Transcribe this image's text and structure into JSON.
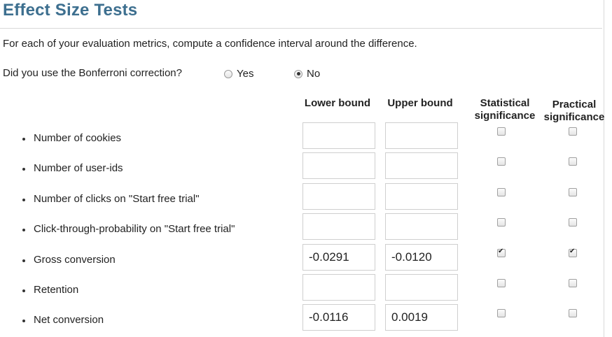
{
  "page": {
    "title": "Effect Size Tests",
    "intro": "For each of your evaluation metrics, compute a confidence interval around the difference."
  },
  "bonferroni": {
    "question": "Did you use the Bonferroni correction?",
    "options": [
      {
        "label": "Yes",
        "checked": false
      },
      {
        "label": "No",
        "checked": true
      }
    ]
  },
  "columns": {
    "lower": "Lower bound",
    "upper": "Upper bound",
    "stat_line1": "Statistical",
    "stat_line2": "significance",
    "prac_line1": "Practical",
    "prac_line2": "significance"
  },
  "metrics": [
    {
      "label": "Number of cookies",
      "lower": "",
      "upper": "",
      "statistical": false,
      "practical": false
    },
    {
      "label": "Number of user-ids",
      "lower": "",
      "upper": "",
      "statistical": false,
      "practical": false
    },
    {
      "label": "Number of clicks on \"Start free trial\"",
      "lower": "",
      "upper": "",
      "statistical": false,
      "practical": false
    },
    {
      "label": "Click-through-probability on \"Start free trial\"",
      "lower": "",
      "upper": "",
      "statistical": false,
      "practical": false
    },
    {
      "label": "Gross conversion",
      "lower": "-0.0291",
      "upper": "-0.0120",
      "statistical": true,
      "practical": true
    },
    {
      "label": "Retention",
      "lower": "",
      "upper": "",
      "statistical": false,
      "practical": false
    },
    {
      "label": "Net conversion",
      "lower": "-0.0116",
      "upper": "0.0019",
      "statistical": false,
      "practical": false
    }
  ]
}
